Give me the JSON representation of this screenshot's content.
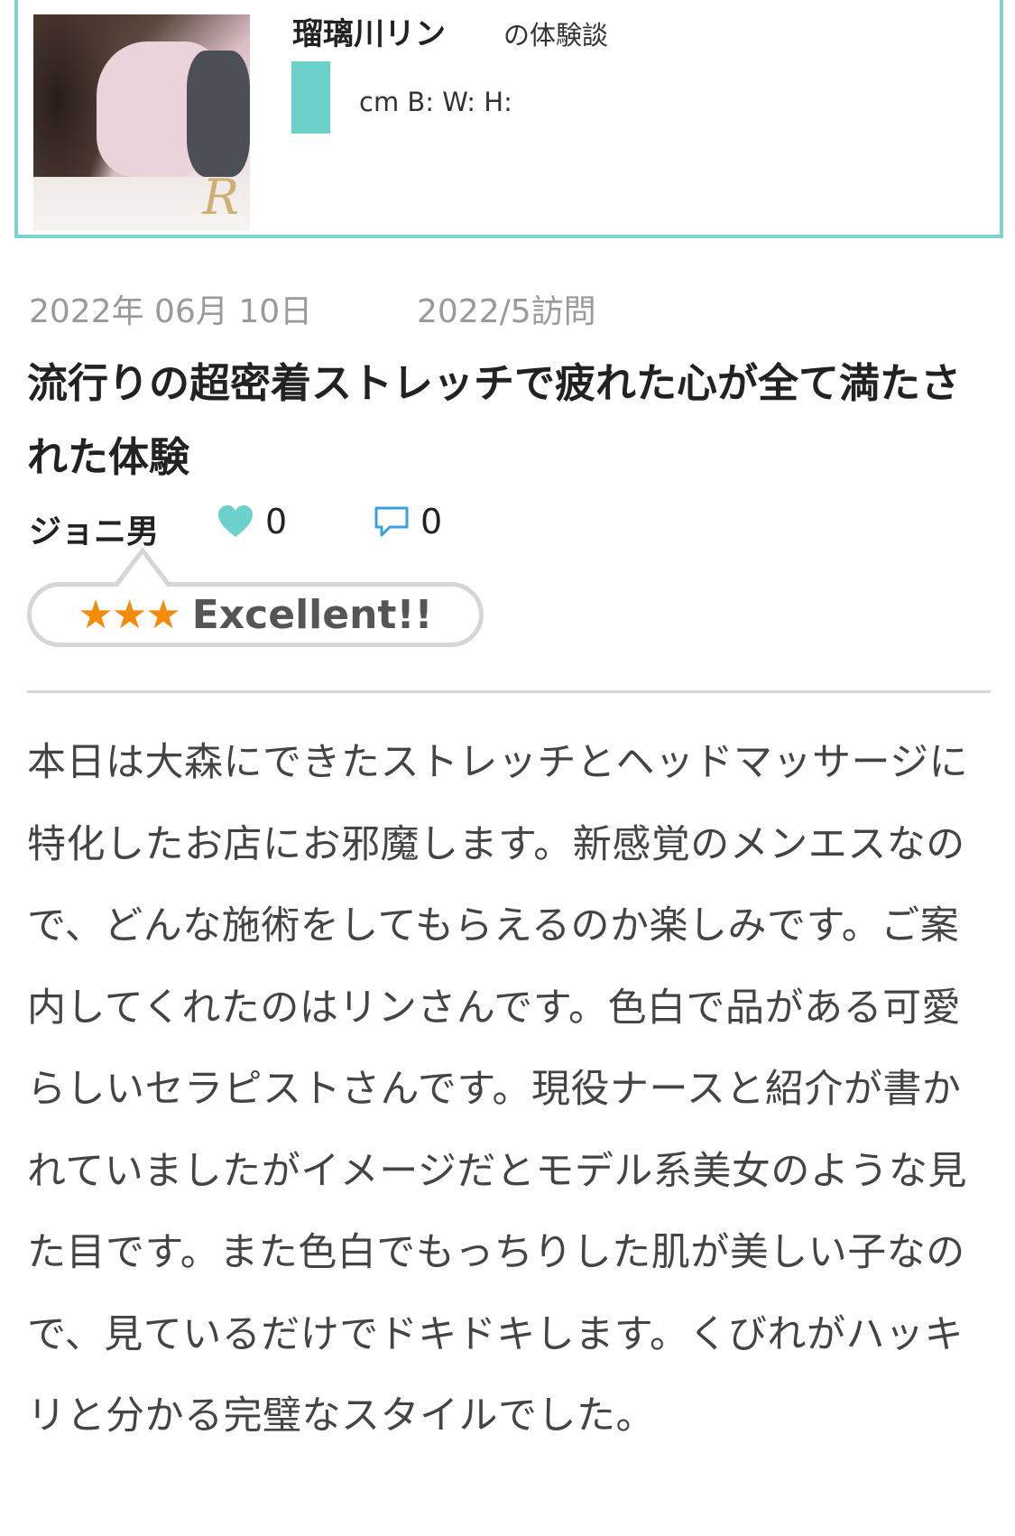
{
  "therapist": {
    "name": "瑠璃川リン",
    "name_suffix": "の体験談",
    "measurements": "cm B: W: H:",
    "photo_logo": "R"
  },
  "review": {
    "date": "2022年 06月 10日",
    "visit": "2022/5訪問",
    "title": "流行りの超密着ストレッチで疲れた心が全て満たされた体験",
    "author": "ジョニ男",
    "likes": "0",
    "comments": "0",
    "rating": {
      "stars": 3,
      "stars_text": "★★★",
      "label": "Excellent!!"
    },
    "body": "本日は大森にできたストレッチとヘッドマッサージに特化したお店にお邪魔します。新感覚のメンエスなので、どんな施術をしてもらえるのか楽しみです。ご案内してくれたのはリンさんです。色白で品がある可愛らしいセラピストさんです。現役ナースと紹介が書かれていましたがイメージだとモデル系美女のような見た目です。また色白でもっちりした肌が美しい子なので、見ているだけでドキドキします。くびれがハッキリと分かる完璧なスタイルでした。"
  },
  "colors": {
    "accent_teal": "#6cd0cb",
    "card_border": "#7fd3cf",
    "star_orange": "#f58a07",
    "meta_gray": "#9a9a9a",
    "comment_blue": "#3aa0e0"
  },
  "icons": {
    "like": "heart-icon",
    "comment": "speech-bubble-icon"
  }
}
